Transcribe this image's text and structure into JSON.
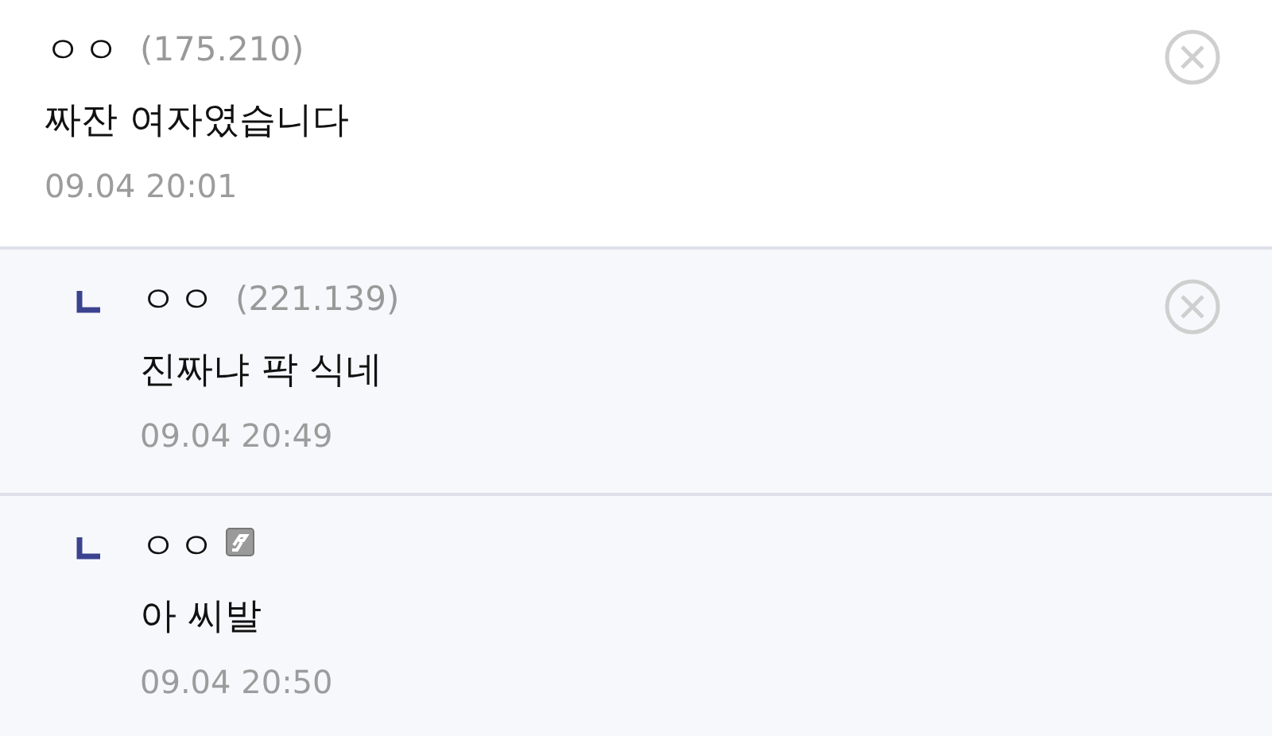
{
  "comments": [
    {
      "kind": "comment",
      "author": "ㅇㅇ",
      "ip": "(175.210)",
      "member_badge": false,
      "text": "짜잔 여자였습니다",
      "time": "09.04 20:01",
      "deletable": true
    },
    {
      "kind": "reply",
      "author": "ㅇㅇ",
      "ip": "(221.139)",
      "member_badge": false,
      "text": "진짜냐 팍 식네",
      "time": "09.04 20:49",
      "deletable": true
    },
    {
      "kind": "reply",
      "author": "ㅇㅇ",
      "member_badge": true,
      "text": "아 씨발",
      "time": "09.04 20:50",
      "deletable": false
    }
  ]
}
